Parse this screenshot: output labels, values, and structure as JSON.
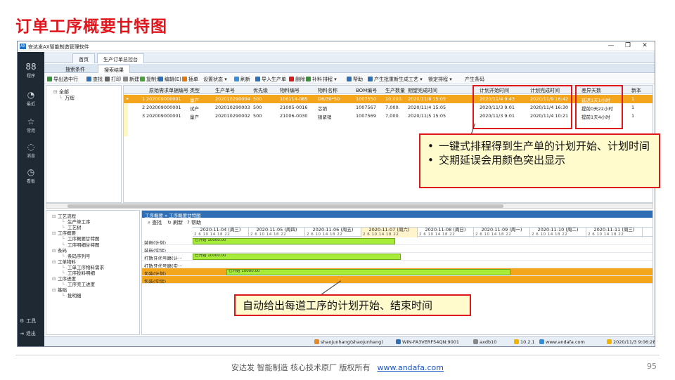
{
  "slide": {
    "title": "订单工序概要甘特图",
    "footer_text": "安达发 智能制造 核心技术原厂 版权所有",
    "footer_link": "www.andafa.com",
    "page_number": "95"
  },
  "app": {
    "logo": "AX",
    "title": "安达发AX智能制造管理软件",
    "win_controls": [
      "—",
      "❐",
      "✕"
    ]
  },
  "leftbar": {
    "items": [
      {
        "icon": "apps-icon",
        "glyph": "88",
        "label": "程序"
      },
      {
        "icon": "clock-icon",
        "glyph": "◔",
        "label": "最近"
      },
      {
        "icon": "star-icon",
        "glyph": "☆",
        "label": "常用"
      },
      {
        "icon": "message-icon",
        "glyph": "◌",
        "label": "消息"
      },
      {
        "icon": "dashboard-icon",
        "glyph": "◷",
        "label": "看板"
      }
    ],
    "bottom": [
      {
        "icon": "tools-icon",
        "glyph": "⚙",
        "label": "工具"
      },
      {
        "icon": "exit-icon",
        "glyph": "⇥",
        "label": "退出"
      }
    ]
  },
  "nav": {
    "tabs": [
      "首页",
      "生产订单总控台"
    ],
    "subtabs": [
      "搜索条件",
      "搜索结果"
    ]
  },
  "toolbar": {
    "buttons": [
      {
        "label": "导出选中行",
        "color": "#3a8f3a"
      },
      {
        "label": "查找",
        "color": "#2f6fb5"
      },
      {
        "label": "打印",
        "color": "#666666"
      },
      {
        "label": "新建",
        "color": "#888888"
      },
      {
        "label": "复制为",
        "color": "#4aa33a"
      },
      {
        "label": "编辑(E)",
        "color": "#2f6fb5"
      },
      {
        "label": "插单",
        "color": "#d97a1a"
      },
      {
        "label": "设置状态 ▾",
        "color": ""
      },
      {
        "label": "刷新",
        "color": "#3a8fd8"
      },
      {
        "label": "导入生产单",
        "color": "#2f6fb5"
      },
      {
        "label": "删除",
        "color": "#d21d1d"
      },
      {
        "label": "补料",
        "color": "#3a8f3a"
      },
      {
        "label": "排程 ▾",
        "color": ""
      },
      {
        "label": "帮助",
        "color": "#2f6fb5"
      },
      {
        "label": "产生批",
        "color": "#2f6fb5"
      },
      {
        "label": "重新生成工艺 ▾",
        "color": ""
      },
      {
        "label": "锁定排程 ▾",
        "color": ""
      },
      {
        "label": "产生条码",
        "color": ""
      }
    ]
  },
  "tree": {
    "nodes": [
      "全部",
      "万辉"
    ]
  },
  "grid": {
    "columns": [
      "原始需求单据编号",
      "类型",
      "生产单号",
      "优先级",
      "物料编号",
      "物料名称",
      "BOM编号",
      "生产数量",
      "期望完成时间",
      "计划开始时间",
      "计划完成时间",
      "差异天数",
      "新本"
    ],
    "rows": [
      {
        "no": "1",
        "src": "202009000001",
        "type": "量产",
        "order": "202010290004",
        "prio": "500",
        "mat": "106114-085",
        "name": "D6/30*50",
        "bom": "1007550",
        "qty": "10,000.",
        "expect": "2020/11/8 15:05",
        "start": "2020/11/4 9:43",
        "end": "2020/11/9 16:42",
        "diff": "延迟1天1小时",
        "ver": "1"
      },
      {
        "no": "2",
        "src": "202009000001",
        "type": "试产",
        "order": "202010290003",
        "prio": "500",
        "mat": "21005-0016",
        "name": "芯销",
        "bom": "1007567",
        "qty": "7,000.",
        "expect": "2020/11/4 15:05",
        "start": "2020/11/3 9:01",
        "end": "2020/11/4 16:30",
        "diff": "提前0天22小时",
        "ver": "1"
      },
      {
        "no": "3",
        "src": "202009000001",
        "type": "量产",
        "order": "202010290002",
        "prio": "500",
        "mat": "21006-0030",
        "name": "锁紧销",
        "bom": "1007569",
        "qty": "7,000.",
        "expect": "2020/11/5 15:05",
        "start": "2020/11/3 9:01",
        "end": "2020/11/4 10:21",
        "diff": "提前1天4小时",
        "ver": "1"
      }
    ]
  },
  "tree2": {
    "nodes": [
      {
        "label": "工艺流程",
        "level": 0
      },
      {
        "label": "生产单工序",
        "level": 1
      },
      {
        "label": "工艺树",
        "level": 1
      },
      {
        "label": "工序概要",
        "level": 0
      },
      {
        "label": "工序概要甘特图",
        "level": 1
      },
      {
        "label": "工序明细甘特图",
        "level": 1
      },
      {
        "label": "条码",
        "level": 0
      },
      {
        "label": "条码序列号",
        "level": 1
      },
      {
        "label": "工单物料",
        "level": 0
      },
      {
        "label": "工单工序物料需求",
        "level": 1
      },
      {
        "label": "工序投料明细",
        "level": 1
      },
      {
        "label": "工序进度",
        "level": 0
      },
      {
        "label": "工序完工进度",
        "level": 1
      },
      {
        "label": "基础",
        "level": 0
      },
      {
        "label": "批明细",
        "level": 1
      }
    ]
  },
  "gantt": {
    "panel_title": "工序概要 » 工序概要甘特图",
    "tools": [
      "查找",
      "刷新",
      "帮助"
    ],
    "days": [
      {
        "date": "2020-11-04 (周三)",
        "hours": "2 6 10 14 18 22",
        "highlight": false
      },
      {
        "date": "2020-11-05 (周四)",
        "hours": "2 6 10 14 18 22",
        "highlight": false
      },
      {
        "date": "2020-11-06 (周五)",
        "hours": "2 6 10 14 18 22",
        "highlight": false
      },
      {
        "date": "2020-11-07 (周六)",
        "hours": "2 6 10 14 18 22",
        "highlight": true
      },
      {
        "date": "2020-11-08 (周日)",
        "hours": "2 6 10 14 18 22",
        "highlight": false
      },
      {
        "date": "2020-11-09 (周一)",
        "hours": "2 6 10 14 18 22",
        "highlight": false
      },
      {
        "date": "2020-11-10 (周二)",
        "hours": "2 6 10 14 18 22",
        "highlight": false
      },
      {
        "date": "2020-11-11 (周三)",
        "hours": "2 6 10 14 18 22",
        "highlight": false
      },
      {
        "date": "202",
        "hours": "",
        "highlight": false
      }
    ],
    "rows": [
      {
        "label": "装嵌(计划)",
        "orange": false,
        "bar_start_day": 0,
        "bar_days": 3.6,
        "bar_text": "已开始\n10000.00"
      },
      {
        "label": "装嵌(实际)",
        "orange": false,
        "bar_start_day": null,
        "bar_days": 0,
        "bar_text": ""
      },
      {
        "label": "打散牙代号磨(计···",
        "orange": false,
        "bar_start_day": 0,
        "bar_days": 3.7,
        "bar_text": "已开始\n10000.00"
      },
      {
        "label": "打散牙代号磨(实···",
        "orange": false,
        "bar_start_day": null,
        "bar_days": 0,
        "bar_text": ""
      },
      {
        "label": "包装(计划)",
        "orange": true,
        "bar_start_day": 0.6,
        "bar_days": 5.05,
        "bar_text": "已开始\n10000.00"
      },
      {
        "label": "包装(实际)",
        "orange": true,
        "bar_start_day": null,
        "bar_days": 0,
        "bar_text": ""
      }
    ]
  },
  "status": {
    "items": [
      {
        "label": "shaojunhang(shaojunhang)",
        "color": "#e08a2a"
      },
      {
        "label": "WIN-FA3VERF54QN:9001",
        "color": "#2f6fb5"
      },
      {
        "label": "axdb10",
        "color": "#888888"
      },
      {
        "label": "10.2.1",
        "color": "#f0b400"
      },
      {
        "label": "www.andafa.com",
        "color": "#2f8fd8"
      },
      {
        "label": "2020/11/3 9:06:28",
        "color": "#f0b400"
      }
    ]
  },
  "callouts": {
    "top": [
      "一键式排程得到生产单的计划开始、计划时间",
      "交期延误会用颜色突出显示"
    ],
    "bottom": "自动给出每道工序的计划开始、结束时间"
  }
}
